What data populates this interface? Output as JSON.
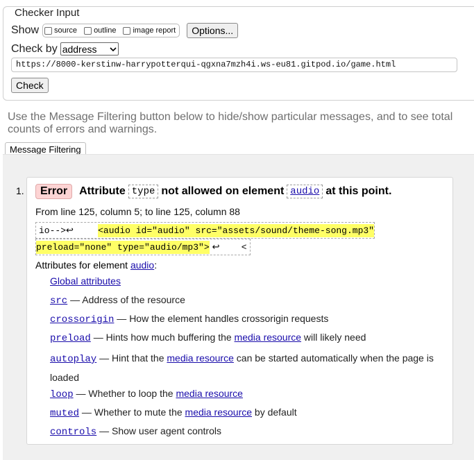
{
  "checker": {
    "legend": "Checker Input",
    "show_label": "Show",
    "options": [
      {
        "label": "source",
        "checked": false
      },
      {
        "label": "outline",
        "checked": false
      },
      {
        "label": "image report",
        "checked": false
      }
    ],
    "options_button": "Options...",
    "check_by_label": "Check by",
    "check_by_value": "address",
    "url": "https://8000-kerstinw-harrypotterqui-qgxna7mzh4i.ws-eu81.gitpod.io/game.html",
    "check_button": "Check"
  },
  "help_text": "Use the Message Filtering button below to hide/show particular messages, and to see total counts of errors and warnings.",
  "filter_button": "Message Filtering",
  "message": {
    "number": "1.",
    "badge": "Error",
    "text_1": "Attribute",
    "code_1": "type",
    "text_2": "not allowed on element",
    "code_2": "audio",
    "text_3": "at this point.",
    "location": "From line 125, column 5; to line 125, column 88",
    "extract": {
      "pre": "io-->↩    ",
      "highlight_1": "<audio id=\"audio\" src=\"assets/sound/theme-song.mp3\"",
      "highlight_2": "preload=\"none\" type=\"audio/mp3\">",
      "post": "↩    <"
    },
    "attr_intro": "Attributes for element ",
    "attr_intro_element": "audio",
    "attr_intro_colon": ":",
    "attributes": [
      {
        "name": "Global attributes",
        "desc": "",
        "mono": false
      },
      {
        "name": "src",
        "desc": " — Address of the resource",
        "mono": true
      },
      {
        "name": "crossorigin",
        "desc": " — How the element handles crossorigin requests",
        "mono": true
      },
      {
        "name": "preload",
        "desc": " — Hints how much buffering the ",
        "link": "media resource",
        "desc2": " will likely need",
        "mono": true
      },
      {
        "name": "autoplay",
        "desc": " — Hint that the ",
        "link": "media resource",
        "desc2": " can be started automatically when the page is loaded",
        "mono": true
      },
      {
        "name": "loop",
        "desc": " — Whether to loop the ",
        "link": "media resource",
        "desc2": "",
        "mono": true
      },
      {
        "name": "muted",
        "desc": " — Whether to mute the ",
        "link": "media resource",
        "desc2": " by default",
        "mono": true
      },
      {
        "name": "controls",
        "desc": " — Show user agent controls",
        "mono": true
      }
    ]
  }
}
